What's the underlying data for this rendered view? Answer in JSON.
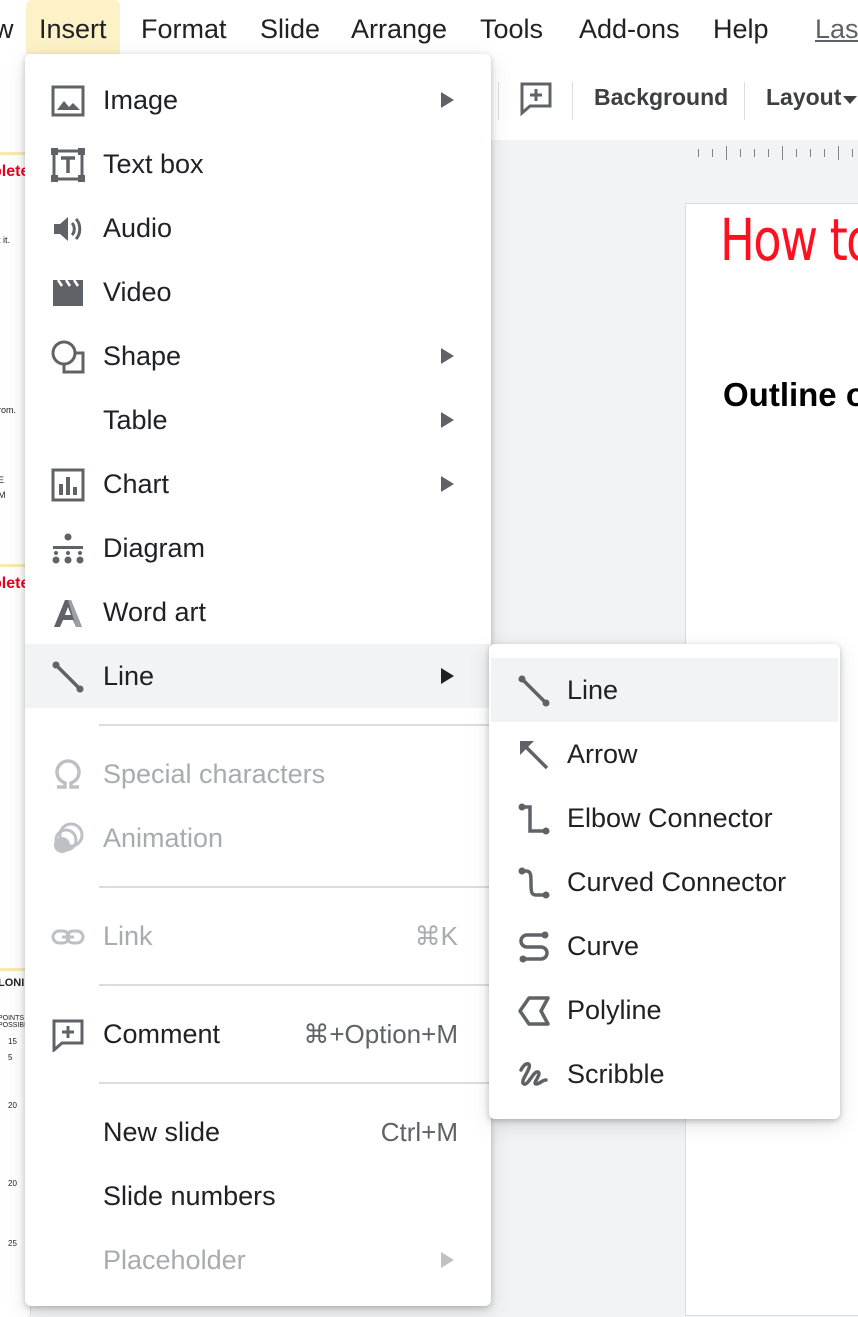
{
  "menubar": {
    "items": [
      "w",
      "Insert",
      "Format",
      "Slide",
      "Arrange",
      "Tools",
      "Add-ons",
      "Help",
      "Las"
    ]
  },
  "toolbar": {
    "background_label": "Background",
    "layout_label": "Layout"
  },
  "filmstrip": {
    "thumb1_title": "plete",
    "thumb1_lines": [
      "t it.",
      "rom.",
      "E",
      "M"
    ],
    "thumb2_title": "plete",
    "thumb3_header": "LONI",
    "thumb3_sub": "POINTS POSSIBL",
    "thumb3_values": [
      "15",
      "5",
      "20",
      "20",
      "25"
    ]
  },
  "slide": {
    "title": "How to",
    "outline": "Outline o"
  },
  "insert_menu": {
    "items": [
      {
        "label": "Image",
        "icon": "image-icon",
        "submenu": true
      },
      {
        "label": "Text box",
        "icon": "text-box-icon"
      },
      {
        "label": "Audio",
        "icon": "audio-icon"
      },
      {
        "label": "Video",
        "icon": "video-icon"
      },
      {
        "label": "Shape",
        "icon": "shape-icon",
        "submenu": true
      },
      {
        "label": "Table",
        "submenu": true
      },
      {
        "label": "Chart",
        "icon": "chart-icon",
        "submenu": true
      },
      {
        "label": "Diagram",
        "icon": "diagram-icon"
      },
      {
        "label": "Word art",
        "icon": "word-art-icon"
      },
      {
        "label": "Line",
        "icon": "line-icon",
        "submenu": true,
        "highlighted": true
      },
      {
        "label": "Special characters",
        "icon": "omega-icon",
        "disabled": true
      },
      {
        "label": "Animation",
        "icon": "animation-icon",
        "disabled": true
      },
      {
        "label": "Link",
        "icon": "link-icon",
        "shortcut": "⌘K",
        "disabled": true
      },
      {
        "label": "Comment",
        "icon": "comment-icon",
        "shortcut": "⌘+Option+M"
      },
      {
        "label": "New slide",
        "shortcut": "Ctrl+M"
      },
      {
        "label": "Slide numbers"
      },
      {
        "label": "Placeholder",
        "submenu": true,
        "disabled": true
      }
    ]
  },
  "line_submenu": {
    "items": [
      {
        "label": "Line",
        "icon": "line-icon",
        "highlighted": true
      },
      {
        "label": "Arrow",
        "icon": "arrow-icon"
      },
      {
        "label": "Elbow Connector",
        "icon": "elbow-connector-icon"
      },
      {
        "label": "Curved Connector",
        "icon": "curved-connector-icon"
      },
      {
        "label": "Curve",
        "icon": "curve-icon"
      },
      {
        "label": "Polyline",
        "icon": "polyline-icon"
      },
      {
        "label": "Scribble",
        "icon": "scribble-icon"
      }
    ]
  },
  "colors": {
    "menu_highlight": "#f1f3f4",
    "active_menu_bg": "#fdf1c8",
    "slide_title_red": "#ff0f1f",
    "disabled_text": "#a8abaf"
  }
}
